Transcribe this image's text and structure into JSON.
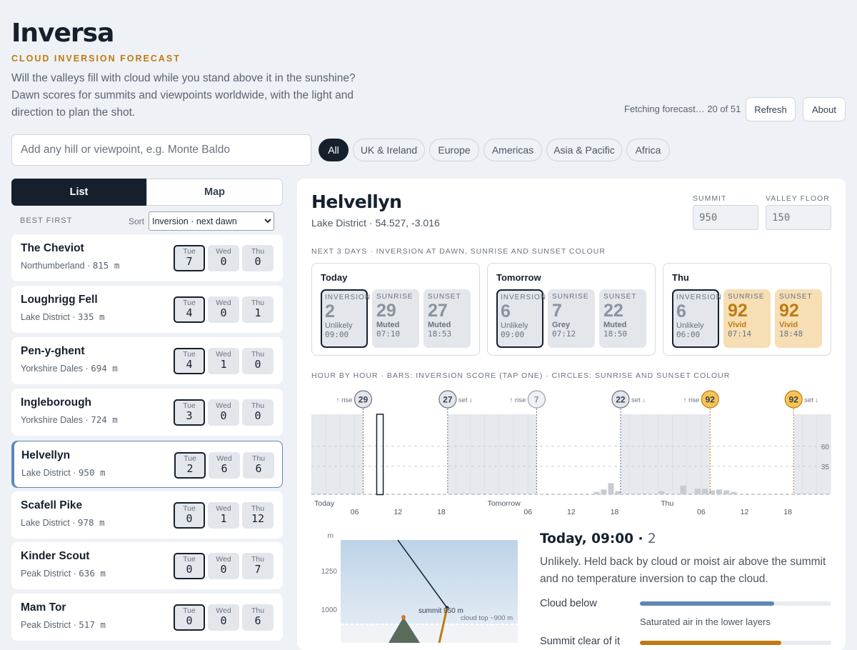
{
  "app": {
    "title": "Inversa",
    "subtitle": "CLOUD INVERSION FORECAST",
    "tagline": "Will the valleys fill with cloud while you stand above it in the sunshine? Dawn scores for summits and viewpoints worldwide, with the light and direction to plan the shot."
  },
  "header": {
    "status": "Fetching forecast… 20 of 51",
    "refresh_label": "Refresh",
    "about_label": "About"
  },
  "search": {
    "placeholder": "Add any hill or viewpoint, e.g. Monte Baldo",
    "value": ""
  },
  "regions": {
    "selected": "All",
    "items": [
      "All",
      "UK & Ireland",
      "Europe",
      "Americas",
      "Asia & Pacific",
      "Africa"
    ]
  },
  "view_toggle": {
    "list_label": "List",
    "map_label": "Map",
    "selected": "List"
  },
  "sort": {
    "label_left": "BEST FIRST",
    "label": "Sort",
    "selected": "Inversion · next dawn"
  },
  "locations": [
    {
      "name": "The Cheviot",
      "region": "Northumberland ·",
      "elev": "815 m",
      "days": [
        {
          "d": "Tue",
          "v": "7"
        },
        {
          "d": "Wed",
          "v": "0"
        },
        {
          "d": "Thu",
          "v": "0"
        }
      ]
    },
    {
      "name": "Loughrigg Fell",
      "region": "Lake District ·",
      "elev": "335 m",
      "days": [
        {
          "d": "Tue",
          "v": "4"
        },
        {
          "d": "Wed",
          "v": "0"
        },
        {
          "d": "Thu",
          "v": "1"
        }
      ]
    },
    {
      "name": "Pen-y-ghent",
      "region": "Yorkshire Dales ·",
      "elev": "694 m",
      "days": [
        {
          "d": "Tue",
          "v": "4"
        },
        {
          "d": "Wed",
          "v": "1"
        },
        {
          "d": "Thu",
          "v": "0"
        }
      ]
    },
    {
      "name": "Ingleborough",
      "region": "Yorkshire Dales ·",
      "elev": "724 m",
      "days": [
        {
          "d": "Tue",
          "v": "3"
        },
        {
          "d": "Wed",
          "v": "0"
        },
        {
          "d": "Thu",
          "v": "0"
        }
      ]
    },
    {
      "name": "Helvellyn",
      "region": "Lake District ·",
      "elev": "950 m",
      "days": [
        {
          "d": "Tue",
          "v": "2"
        },
        {
          "d": "Wed",
          "v": "6"
        },
        {
          "d": "Thu",
          "v": "6"
        }
      ]
    },
    {
      "name": "Scafell Pike",
      "region": "Lake District ·",
      "elev": "978 m",
      "days": [
        {
          "d": "Tue",
          "v": "0"
        },
        {
          "d": "Wed",
          "v": "1"
        },
        {
          "d": "Thu",
          "v": "12"
        }
      ]
    },
    {
      "name": "Kinder Scout",
      "region": "Peak District ·",
      "elev": "636 m",
      "days": [
        {
          "d": "Tue",
          "v": "0"
        },
        {
          "d": "Wed",
          "v": "0"
        },
        {
          "d": "Thu",
          "v": "7"
        }
      ]
    },
    {
      "name": "Mam Tor",
      "region": "Peak District ·",
      "elev": "517 m",
      "days": [
        {
          "d": "Tue",
          "v": "0"
        },
        {
          "d": "Wed",
          "v": "0"
        },
        {
          "d": "Thu",
          "v": "6"
        }
      ]
    }
  ],
  "detail": {
    "name": "Helvellyn",
    "location": "Lake District · 54.527, -3.016",
    "summit_label": "SUMMIT",
    "summit_placeholder": "950",
    "valley_label": "VALLEY FLOOR",
    "valley_placeholder": "150",
    "next3_label": "NEXT 3 DAYS · INVERSION AT DAWN, SUNRISE AND SUNSET COLOUR",
    "days": [
      {
        "label": "Today",
        "tiles": [
          {
            "l": "INVERSION",
            "v": "2",
            "q": "Unlikely",
            "t": "09:00"
          },
          {
            "l": "SUNRISE",
            "v": "29",
            "q": "Muted",
            "t": "07:10"
          },
          {
            "l": "SUNSET",
            "v": "27",
            "q": "Muted",
            "t": "18:53"
          }
        ]
      },
      {
        "label": "Tomorrow",
        "tiles": [
          {
            "l": "INVERSION",
            "v": "6",
            "q": "Unlikely",
            "t": "09:00"
          },
          {
            "l": "SUNRISE",
            "v": "7",
            "q": "Grey",
            "t": "07:12"
          },
          {
            "l": "SUNSET",
            "v": "22",
            "q": "Muted",
            "t": "18:50"
          }
        ]
      },
      {
        "label": "Thu",
        "tiles": [
          {
            "l": "INVERSION",
            "v": "6",
            "q": "Unlikely",
            "t": "06:00"
          },
          {
            "l": "SUNRISE",
            "v": "92",
            "q": "Vivid",
            "t": "07:14"
          },
          {
            "l": "SUNSET",
            "v": "92",
            "q": "Vivid",
            "t": "18:48"
          }
        ]
      }
    ],
    "hourly_label": "HOUR BY HOUR · BARS: INVERSION SCORE (TAP ONE) · CIRCLES: SUNRISE AND SUNSET COLOUR",
    "timeline": {
      "day_labels": [
        "Today",
        "Tomorrow",
        "Thu"
      ],
      "hour_ticks": [
        "06",
        "12",
        "18"
      ],
      "threshold_labels": [
        "60",
        "35"
      ],
      "thresholds": [
        60,
        35
      ],
      "rise_label": "↑ rise",
      "set_label": "set ↓",
      "markers": [
        {
          "day": 0,
          "hour": 7.17,
          "kind": "rise",
          "score": "29"
        },
        {
          "day": 0,
          "hour": 18.88,
          "kind": "set",
          "score": "27"
        },
        {
          "day": 1,
          "hour": 7.2,
          "kind": "rise",
          "score": "7"
        },
        {
          "day": 1,
          "hour": 18.83,
          "kind": "set",
          "score": "22"
        },
        {
          "day": 2,
          "hour": 7.23,
          "kind": "rise",
          "score": "92"
        },
        {
          "day": 2,
          "hour": 18.8,
          "kind": "set",
          "score": "92"
        }
      ],
      "bars": [
        {
          "day": 1,
          "hour": 15,
          "score": 3
        },
        {
          "day": 1,
          "hour": 16,
          "score": 6
        },
        {
          "day": 1,
          "hour": 17,
          "score": 14
        },
        {
          "day": 1,
          "hour": 18,
          "score": 4
        },
        {
          "day": 2,
          "hour": 0,
          "score": 4
        },
        {
          "day": 2,
          "hour": 3,
          "score": 11
        },
        {
          "day": 2,
          "hour": 5,
          "score": 7
        },
        {
          "day": 2,
          "hour": 6,
          "score": 7
        },
        {
          "day": 2,
          "hour": 7,
          "score": 5
        },
        {
          "day": 2,
          "hour": 8,
          "score": 6
        },
        {
          "day": 2,
          "hour": 9,
          "score": 5
        },
        {
          "day": 2,
          "hour": 10,
          "score": 3
        }
      ],
      "selected": {
        "day": 0,
        "hour": 9,
        "score": 2
      }
    },
    "profile": {
      "y_unit": "m",
      "y_ticks": [
        "1250",
        "1000"
      ],
      "summit_label": "summit 950 m",
      "cloud_top_label": "cloud top ~900 m"
    },
    "reading": {
      "title": "Today, 09:00 ·",
      "score": "2",
      "description": "Unlikely. Held back by cloud or moist air above the summit and no temperature inversion to cap the cloud."
    },
    "factors": [
      {
        "label": "Cloud below",
        "value": 0.7,
        "color": "#5f86b5",
        "note": "Saturated air in the lower layers"
      },
      {
        "label": "Summit clear of it",
        "value": 0.74,
        "color": "#c07a12"
      }
    ]
  }
}
